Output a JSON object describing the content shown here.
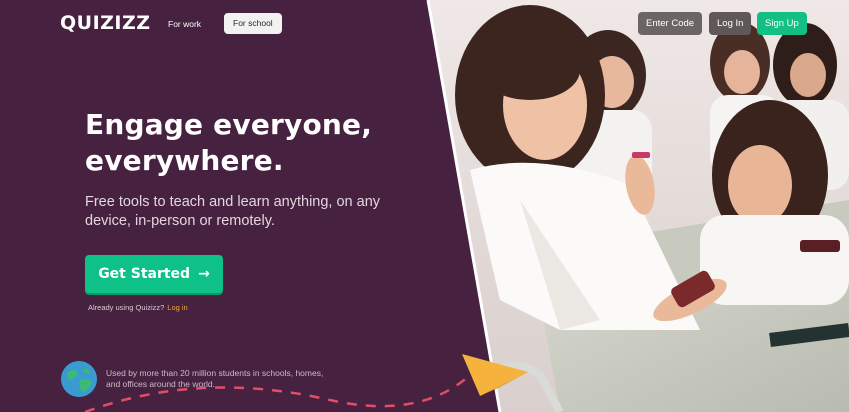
{
  "header": {
    "logo_text": "QUIZIZZ",
    "nav": {
      "for_work": "For work",
      "for_school": "For school"
    },
    "buttons": {
      "enter_code": "Enter Code",
      "log_in": "Log In",
      "sign_up": "Sign Up"
    }
  },
  "hero": {
    "headline_line1": "Engage everyone,",
    "headline_line2": "everywhere.",
    "subtext": "Free tools to teach and learn anything, on any device, in-person or remotely.",
    "cta_label": "Get Started",
    "cta_icon": "arrow-right-icon",
    "already_text": "Already using Quizizz?",
    "already_login": "Log in"
  },
  "footer_stat": {
    "icon": "globe-icon",
    "text": "Used by more than 20 million students in schools, homes, and offices around the world."
  },
  "colors": {
    "hero_background": "#462140",
    "accent_green": "#0ec186",
    "login_link": "#f3a83a",
    "plane": "#f5b23c"
  }
}
